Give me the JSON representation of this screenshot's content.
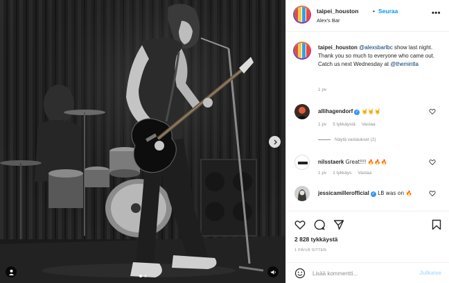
{
  "post": {
    "username": "taipei_houston",
    "separator": "•",
    "follow_label": "Seuraa",
    "location": "Alex's Bar",
    "more_icon": "more-horizontal-icon"
  },
  "caption": {
    "username": "taipei_houston",
    "mention_1": "@alexsbarlbc",
    "text_1": "show last night. Thank you so much to everyone who came out. Catch us next Wednesday at",
    "mention_2": "@themintla",
    "time": "1 pv"
  },
  "comments": [
    {
      "username": "allihagendorf",
      "verified": true,
      "text": "🤘🤘🤘",
      "time": "1 pv",
      "likes": "5 tykkäystä",
      "reply_label": "Vastaa",
      "view_replies": "Näytä vastaukset (2)"
    },
    {
      "username": "nilsstaerk",
      "verified": false,
      "text": "Great!!! 🔥🔥🔥",
      "time": "1 pv",
      "likes": "1 tykkäys",
      "reply_label": "Vastaa"
    },
    {
      "username": "jessicamillerofficial",
      "verified": true,
      "text": "LB was on 🔥"
    }
  ],
  "actions": {
    "likes": "2 828 tykkäystä",
    "posted": "1 PÄIVÄ SITTEN"
  },
  "add_comment": {
    "placeholder": "Lisää kommentti...",
    "publish_label": "Julkaise"
  },
  "colors": {
    "accent": "#0095f6",
    "publish_disabled": "#b2dffc",
    "meta_text": "#8e8e8e"
  }
}
